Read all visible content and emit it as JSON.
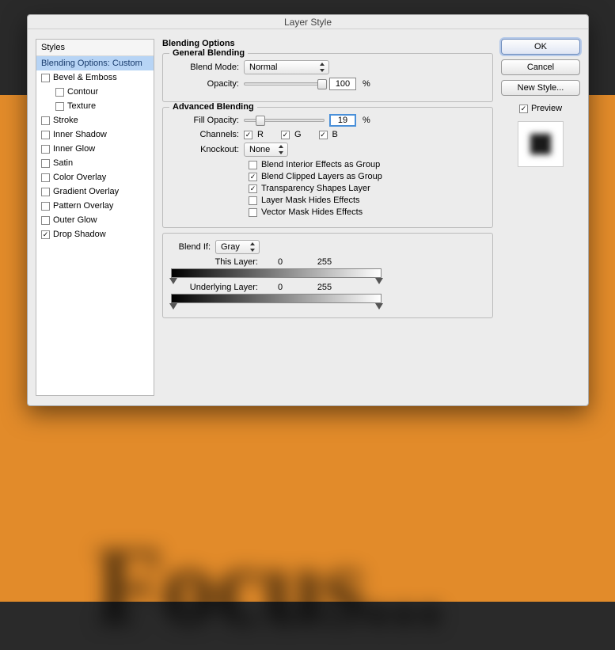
{
  "window": {
    "title": "Layer Style"
  },
  "sidebar": {
    "header": "Styles",
    "selected": "Blending Options: Custom",
    "items": [
      {
        "label": "Bevel & Emboss",
        "checked": false,
        "indent": false
      },
      {
        "label": "Contour",
        "checked": false,
        "indent": true
      },
      {
        "label": "Texture",
        "checked": false,
        "indent": true
      },
      {
        "label": "Stroke",
        "checked": false,
        "indent": false
      },
      {
        "label": "Inner Shadow",
        "checked": false,
        "indent": false
      },
      {
        "label": "Inner Glow",
        "checked": false,
        "indent": false
      },
      {
        "label": "Satin",
        "checked": false,
        "indent": false
      },
      {
        "label": "Color Overlay",
        "checked": false,
        "indent": false
      },
      {
        "label": "Gradient Overlay",
        "checked": false,
        "indent": false
      },
      {
        "label": "Pattern Overlay",
        "checked": false,
        "indent": false
      },
      {
        "label": "Outer Glow",
        "checked": false,
        "indent": false
      },
      {
        "label": "Drop Shadow",
        "checked": true,
        "indent": false
      }
    ]
  },
  "blending": {
    "title": "Blending Options",
    "general": {
      "title": "General Blending",
      "blendModeLabel": "Blend Mode:",
      "blendMode": "Normal",
      "opacityLabel": "Opacity:",
      "opacity": "100",
      "pct": "%"
    },
    "advanced": {
      "title": "Advanced Blending",
      "fillOpacityLabel": "Fill Opacity:",
      "fillOpacity": "19",
      "pct": "%",
      "channelsLabel": "Channels:",
      "r": "R",
      "g": "G",
      "b": "B",
      "rChecked": true,
      "gChecked": true,
      "bChecked": true,
      "knockoutLabel": "Knockout:",
      "knockout": "None",
      "opts": [
        {
          "label": "Blend Interior Effects as Group",
          "checked": false
        },
        {
          "label": "Blend Clipped Layers as Group",
          "checked": true
        },
        {
          "label": "Transparency Shapes Layer",
          "checked": true
        },
        {
          "label": "Layer Mask Hides Effects",
          "checked": false
        },
        {
          "label": "Vector Mask Hides Effects",
          "checked": false
        }
      ]
    },
    "blendif": {
      "label": "Blend If:",
      "mode": "Gray",
      "thisLayerLabel": "This Layer:",
      "thisMin": "0",
      "thisMax": "255",
      "underLabel": "Underlying Layer:",
      "underMin": "0",
      "underMax": "255"
    }
  },
  "buttons": {
    "ok": "OK",
    "cancel": "Cancel",
    "newStyle": "New Style..."
  },
  "preview": {
    "label": "Preview",
    "checked": true
  },
  "canvas": {
    "text": "Focus..."
  }
}
